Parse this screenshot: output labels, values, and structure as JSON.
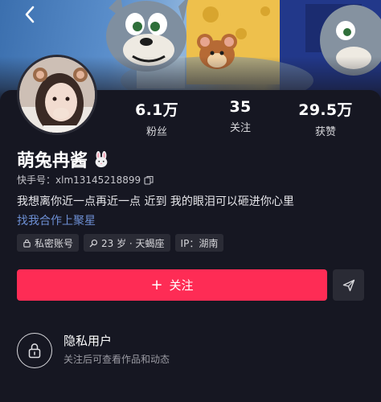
{
  "profile": {
    "name": "萌兔冉酱",
    "kuaishou_label": "快手号：",
    "kuaishou_id": "xlm13145218899",
    "bio": "我想离你近一点再近一点 近到 我的眼泪可以砸进你心里",
    "business_link": "找我合作上聚星"
  },
  "stats": [
    {
      "value": "6.1万",
      "label": "粉丝"
    },
    {
      "value": "35",
      "label": "关注"
    },
    {
      "value": "29.5万",
      "label": "获赞"
    }
  ],
  "tags": [
    {
      "icon": "lock-icon",
      "text": "私密账号"
    },
    {
      "icon": "search-icon",
      "text": "23 岁 · 天蝎座"
    },
    {
      "icon": "",
      "text": "IP：湖南"
    }
  ],
  "actions": {
    "follow_label": "关注",
    "follow_icon": "plus-icon",
    "share_icon": "send-icon"
  },
  "private_section": {
    "title": "隐私用户",
    "description": "关注后可查看作品和动态"
  },
  "colors": {
    "accent": "#fe2c55",
    "background": "#161722",
    "link": "#6d8fd4",
    "chip": "#2a2b35"
  }
}
